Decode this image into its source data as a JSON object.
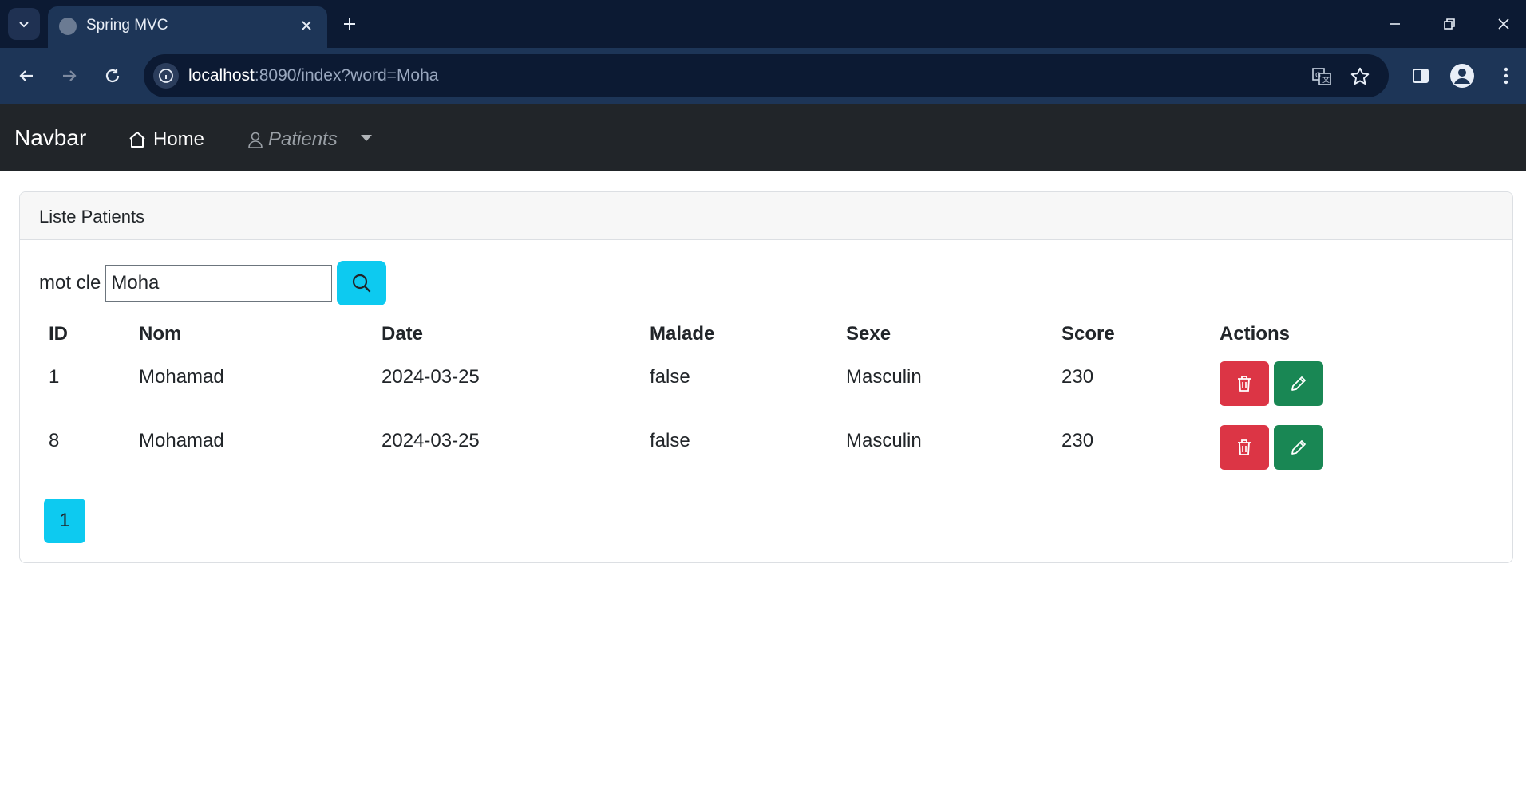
{
  "browser": {
    "tab_title": "Spring MVC",
    "url_host": "localhost",
    "url_rest": ":8090/index?word=Moha"
  },
  "navbar": {
    "brand": "Navbar",
    "home_label": "Home",
    "patients_label": "Patients"
  },
  "card": {
    "header": "Liste Patients",
    "search_label": "mot cle",
    "search_value": "Moha"
  },
  "table": {
    "headers": [
      "ID",
      "Nom",
      "Date",
      "Malade",
      "Sexe",
      "Score",
      "Actions"
    ],
    "rows": [
      {
        "id": "1",
        "nom": "Mohamad",
        "date": "2024-03-25",
        "malade": "false",
        "sexe": "Masculin",
        "score": "230"
      },
      {
        "id": "8",
        "nom": "Mohamad",
        "date": "2024-03-25",
        "malade": "false",
        "sexe": "Masculin",
        "score": "230"
      }
    ]
  },
  "pagination": {
    "pages": [
      "1"
    ]
  },
  "colors": {
    "info": "#0dcaf0",
    "danger": "#dc3545",
    "success": "#198754",
    "navbar_bg": "#212529"
  }
}
